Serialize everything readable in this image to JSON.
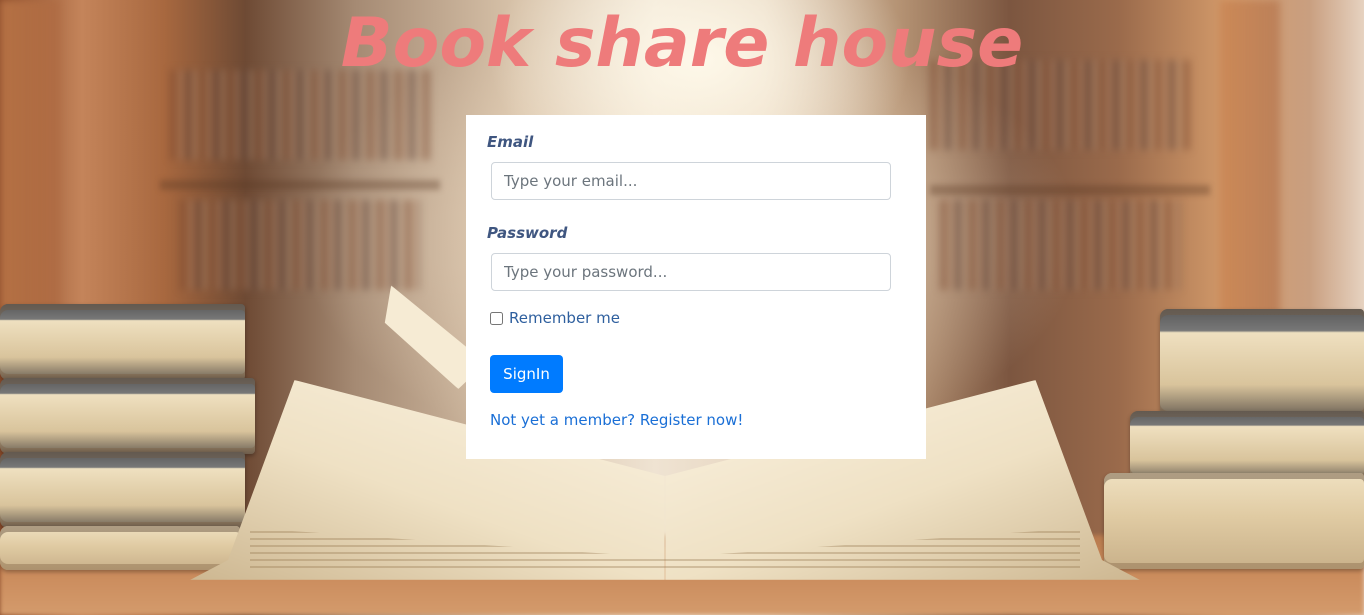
{
  "header": {
    "title": "Book share house"
  },
  "login_form": {
    "email": {
      "label": "Email",
      "placeholder": "Type your email...",
      "value": ""
    },
    "password": {
      "label": "Password",
      "placeholder": "Type your password...",
      "value": ""
    },
    "remember_me": {
      "label": "Remember me",
      "checked": false
    },
    "submit_label": "SignIn",
    "register_link": "Not yet a member? Register now!"
  },
  "colors": {
    "title": "#ee7b7b",
    "primary_button": "#007bff",
    "label": "#3f5680",
    "link": "#1a6fd6"
  }
}
